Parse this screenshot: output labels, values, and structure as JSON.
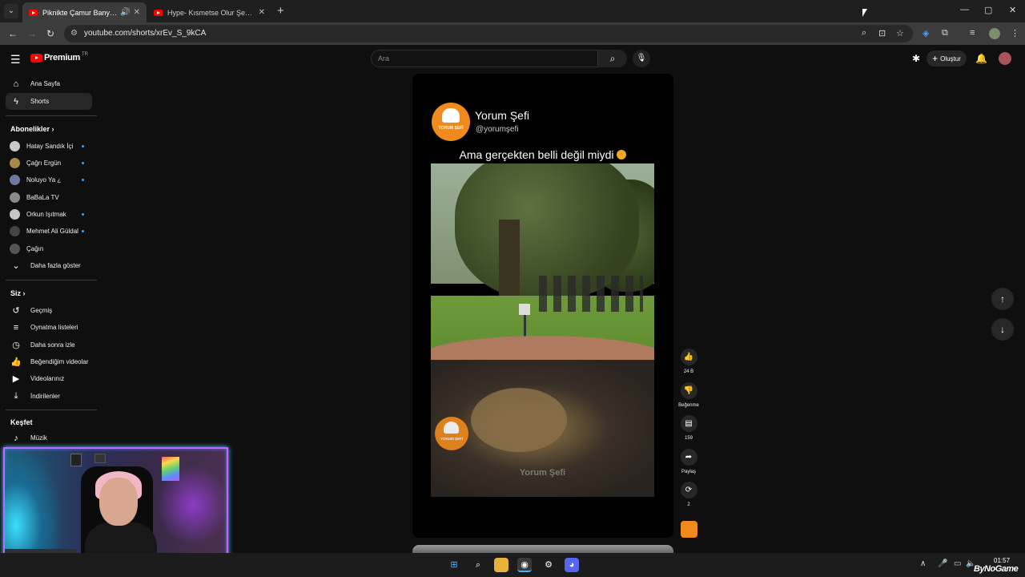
{
  "browser": {
    "tabs": [
      {
        "title": "Piknikte Çamur Banyosu Ke",
        "active": true
      },
      {
        "title": "Hype- Kısmetse Olur Şeydaya T",
        "active": false
      }
    ],
    "url": "youtube.com/shorts/xrEv_S_9kCA",
    "new_tab": "+",
    "tab_menu": "⌄",
    "win_min": "—",
    "win_max": "▢",
    "win_close": "✕"
  },
  "header": {
    "logo_text": "Premium",
    "logo_country": "TR",
    "search_placeholder": "Ara",
    "create_label": "Oluştur"
  },
  "sidebar": {
    "main": [
      {
        "label": "Ana Sayfa",
        "icon": "home-icon"
      },
      {
        "label": "Shorts",
        "icon": "shorts-icon",
        "selected": true
      }
    ],
    "subscriptions_title": "Abonelikler",
    "subscriptions": [
      {
        "name": "Hatay Sandık İçi",
        "color": "#c9c9c9",
        "new": true
      },
      {
        "name": "Çağrı Ergün",
        "color": "#a88a46",
        "new": true
      },
      {
        "name": "Noluyo Ya ¿",
        "color": "#6e7aa0",
        "new": true
      },
      {
        "name": "BaBaLa TV",
        "color": "#8a8a8a",
        "new": false
      },
      {
        "name": "Orkun Işıtmak",
        "color": "#c6c6c6",
        "new": true
      },
      {
        "name": "Mehmet Ali Güldal",
        "color": "#444444",
        "new": true
      },
      {
        "name": "Çağın",
        "color": "#555555",
        "new": false
      }
    ],
    "show_more": "Daha fazla göster",
    "you_title": "Siz",
    "you": [
      {
        "label": "Geçmiş",
        "icon": "history-icon"
      },
      {
        "label": "Oynatma listeleri",
        "icon": "playlist-icon"
      },
      {
        "label": "Daha sonra izle",
        "icon": "clock-icon"
      },
      {
        "label": "Beğendiğim videolar",
        "icon": "like-icon"
      },
      {
        "label": "Videolarınız",
        "icon": "video-icon"
      },
      {
        "label": "İndirilenler",
        "icon": "download-icon"
      }
    ],
    "explore_title": "Keşfet",
    "explore": [
      {
        "label": "Müzik",
        "icon": "music-icon"
      }
    ]
  },
  "short": {
    "channel_name": "Yorum Şefi",
    "channel_handle": "@yorumşefi",
    "caption": "Ama gerçekten belli değil miydi",
    "watermark": "Yorum Şefi",
    "logo_tag": "YORUM ŞEFİ"
  },
  "actions": {
    "likes": "24 B",
    "dislike_label": "Beğenme",
    "comments": "159",
    "share_label": "Paylaş",
    "remix_count": "2"
  },
  "taskbar": {
    "time": "01:57",
    "brand": "ByNoGame"
  },
  "colors": {
    "accent": "#ff0000",
    "background": "#0f0f0f",
    "webcam_border": "#b86bff"
  }
}
